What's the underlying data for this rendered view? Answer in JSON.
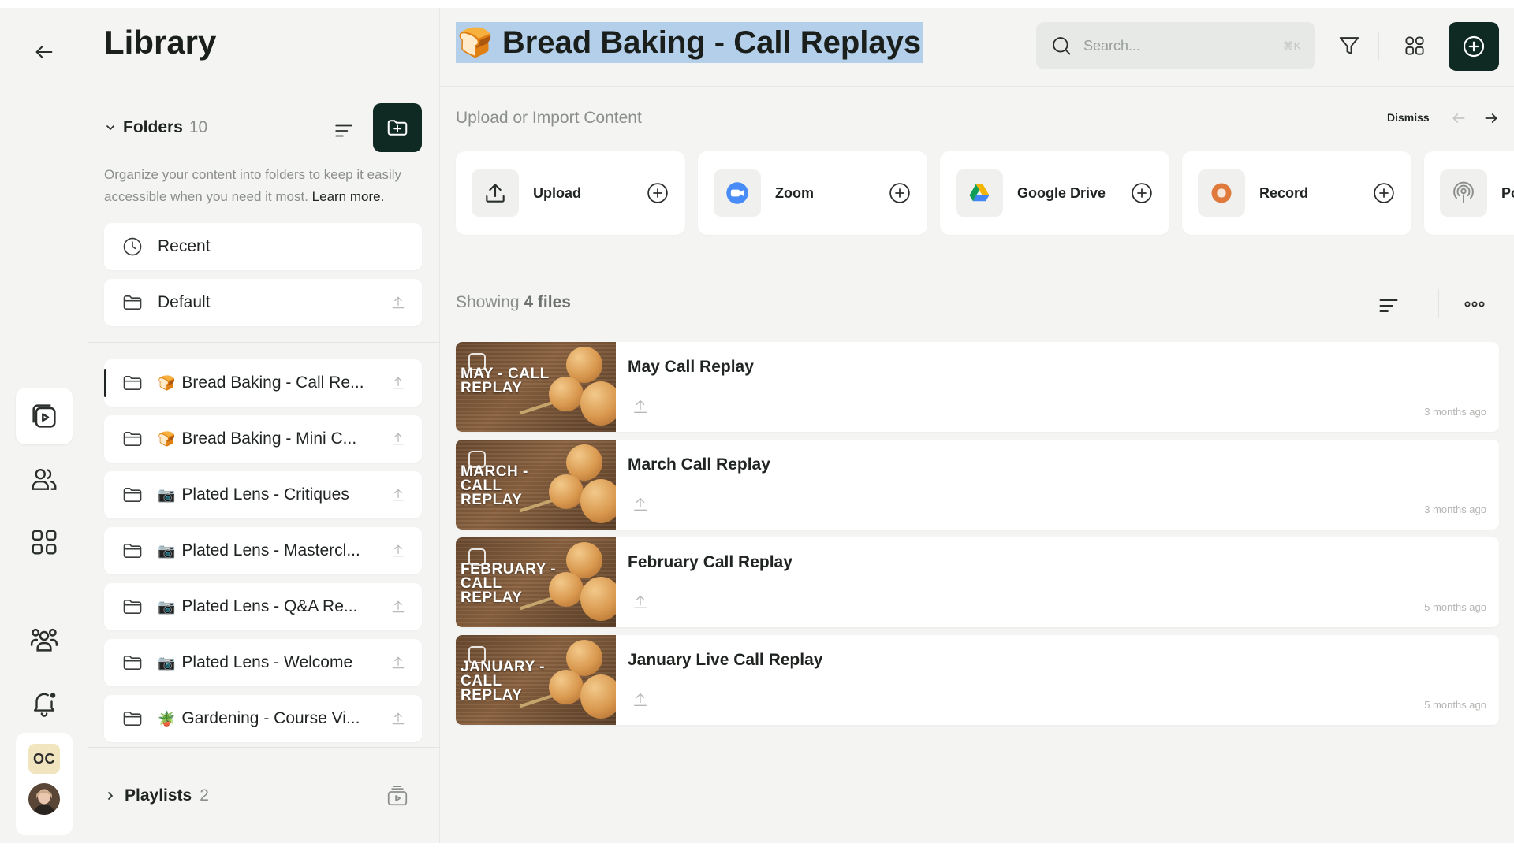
{
  "library": {
    "title": "Library",
    "folders_label": "Folders",
    "folders_count": "10",
    "description": "Organize your content into folders to keep it easily accessible when you need it most.",
    "learn_more": "Learn more.",
    "pinned": [
      {
        "label": "Recent",
        "icon": "clock-icon"
      },
      {
        "label": "Default",
        "icon": "folder-icon"
      }
    ],
    "folders": [
      {
        "emoji": "🍞",
        "label": "Bread Baking - Call Re...",
        "selected": true
      },
      {
        "emoji": "🍞",
        "label": "Bread Baking - Mini C..."
      },
      {
        "emoji": "📷",
        "label": "Plated Lens - Critiques"
      },
      {
        "emoji": "📷",
        "label": "Plated Lens - Mastercl..."
      },
      {
        "emoji": "📷",
        "label": "Plated Lens - Q&A Re..."
      },
      {
        "emoji": "📷",
        "label": "Plated Lens - Welcome"
      },
      {
        "emoji": "🪴",
        "label": "Gardening - Course Vi..."
      }
    ],
    "playlists_label": "Playlists",
    "playlists_count": "2"
  },
  "rail": {
    "profile_initials": "OC"
  },
  "header": {
    "emoji": "🍞",
    "title": "Bread Baking - Call Replays",
    "search_placeholder": "Search...",
    "search_shortcut": "⌘K"
  },
  "upload": {
    "title": "Upload or Import Content",
    "dismiss": "Dismiss",
    "sources": [
      {
        "name": "Upload",
        "icon": "upload-icon"
      },
      {
        "name": "Zoom",
        "icon": "zoom-icon"
      },
      {
        "name": "Google Drive",
        "icon": "google-drive-icon"
      },
      {
        "name": "Record",
        "icon": "record-icon"
      },
      {
        "name": "Po",
        "icon": "podcast-icon"
      }
    ]
  },
  "files": {
    "showing_prefix": "Showing",
    "showing_count": "4 files",
    "items": [
      {
        "title": "May Call Replay",
        "thumb_label": "MAY - CALL REPLAY",
        "ago": "3 months ago"
      },
      {
        "title": "March Call Replay",
        "thumb_label": "MARCH - CALL REPLAY",
        "ago": "3 months ago"
      },
      {
        "title": "February Call Replay",
        "thumb_label": "FEBRUARY - CALL REPLAY",
        "ago": "5 months ago"
      },
      {
        "title": "January Live Call Replay",
        "thumb_label": "JANUARY - CALL REPLAY",
        "ago": "5 months ago"
      }
    ]
  },
  "colors": {
    "accent_dark": "#0f2a23",
    "background": "#f4f5f3",
    "title_highlight": "#b4cfe9"
  }
}
